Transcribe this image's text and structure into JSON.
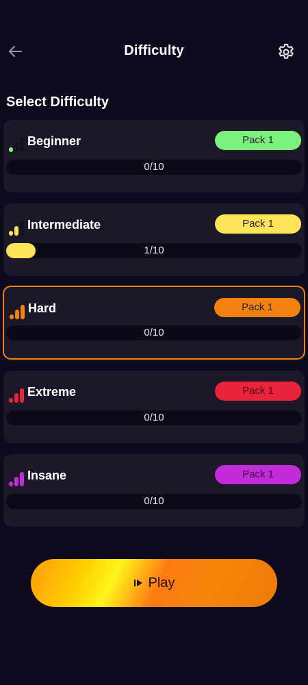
{
  "header": {
    "title": "Difficulty",
    "back_icon": "arrow-left-icon",
    "settings_icon": "gear-icon"
  },
  "section_title": "Select Difficulty",
  "levels": [
    {
      "label": "Beginner",
      "pack": "Pack 1",
      "progress_text": "0/10",
      "progress": 0.0,
      "color": "#7cf07c",
      "bars_active": 1
    },
    {
      "label": "Intermediate",
      "pack": "Pack 1",
      "progress_text": "1/10",
      "progress": 0.1,
      "color": "#fde55a",
      "bars_active": 2
    },
    {
      "label": "Hard",
      "pack": "Pack 1",
      "progress_text": "0/10",
      "progress": 0.0,
      "color": "#f5820f",
      "bars_active": 3,
      "selected": true
    },
    {
      "label": "Extreme",
      "pack": "Pack 1",
      "progress_text": "0/10",
      "progress": 0.0,
      "color": "#e8233a",
      "bars_active": 3
    },
    {
      "label": "Insane",
      "pack": "Pack 1",
      "progress_text": "0/10",
      "progress": 0.0,
      "color": "#c12bd8",
      "bars_active": 3
    }
  ],
  "play": {
    "label": "Play",
    "icon": "play-icon"
  },
  "colors": {
    "background": "#0f0b1e",
    "card": "#1c1829",
    "accent": "#f5820f"
  }
}
